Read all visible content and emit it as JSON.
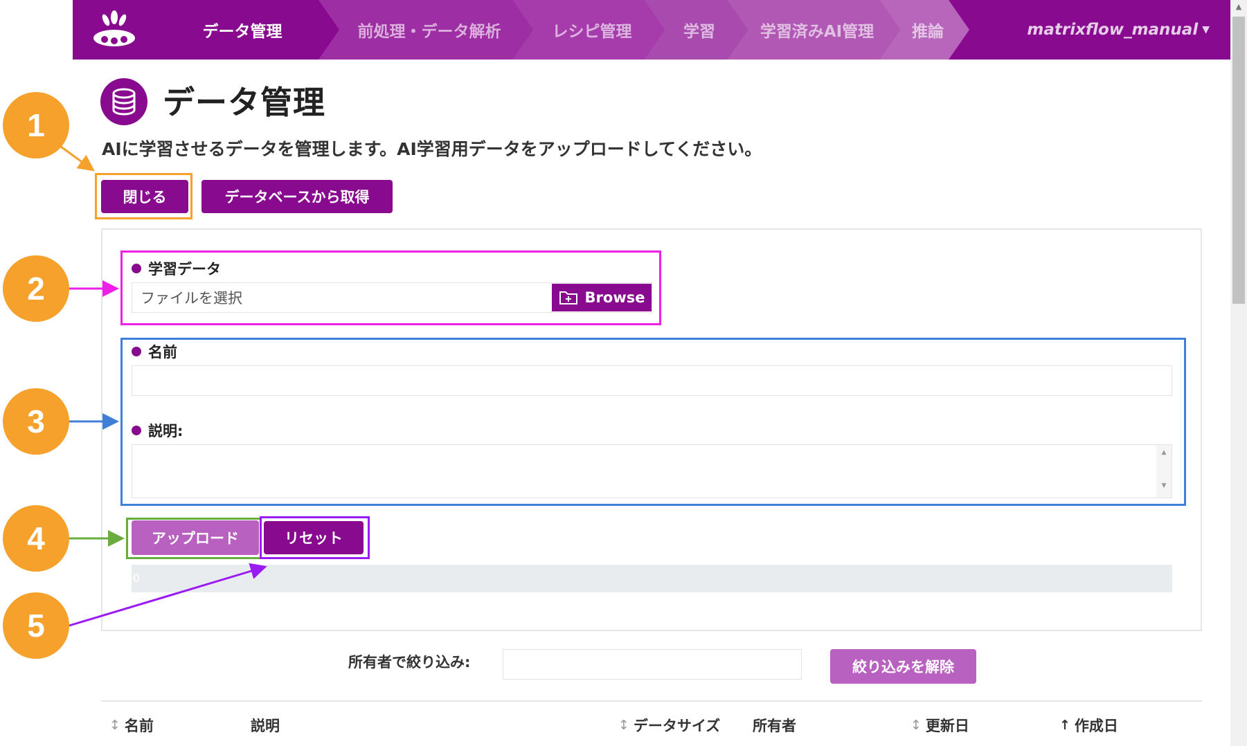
{
  "nav": {
    "steps": [
      "データ管理",
      "前処理・データ解析",
      "レシピ管理",
      "学習",
      "学習済みAI管理",
      "推論"
    ],
    "user": "matrixflow_manual"
  },
  "header": {
    "title": "データ管理",
    "description": "AIに学習させるデータを管理します。AI学習用データをアップロードしてください。"
  },
  "actions": {
    "close_label": "閉じる",
    "db_label": "データベースから取得"
  },
  "form": {
    "training_data_label": "学習データ",
    "file_placeholder": "ファイルを選択",
    "browse_label": "Browse",
    "name_label": "名前",
    "description_label": "説明:",
    "upload_label": "アップロード",
    "reset_label": "リセット",
    "progress_text": "0"
  },
  "filter": {
    "label": "所有者で絞り込み:",
    "clear_label": "絞り込みを解除"
  },
  "table": {
    "columns": [
      "名前",
      "説明",
      "データサイズ",
      "所有者",
      "更新日",
      "作成日"
    ]
  },
  "annotations": [
    "1",
    "2",
    "3",
    "4",
    "5"
  ],
  "colors": {
    "primary": "#880a8e",
    "primary_light": "#b861c0",
    "badge": "#f5a12c",
    "hl_close": "#f5a12c",
    "hl_file": "#ee1fe7",
    "hl_fields": "#3f7fd8",
    "hl_upload": "#6aad3f",
    "hl_reset": "#9b1bf5"
  }
}
